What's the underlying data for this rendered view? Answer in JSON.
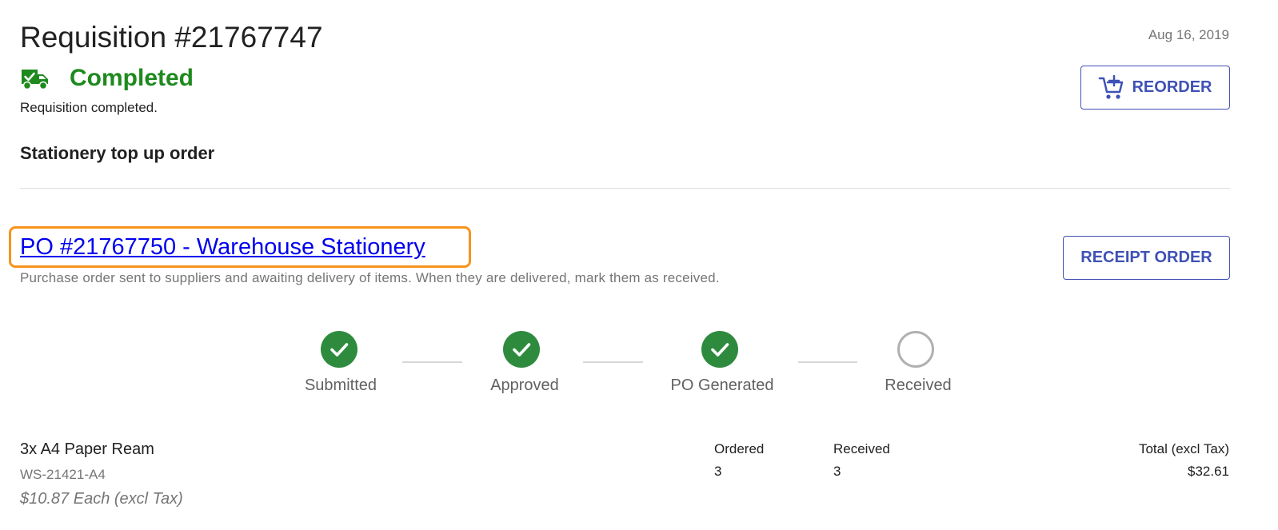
{
  "requisition": {
    "title": "Requisition #21767747",
    "date": "Aug 16, 2019",
    "status": "Completed",
    "status_description": "Requisition completed.",
    "name": "Stationery top up order",
    "reorder_label": "REORDER"
  },
  "purchase_order": {
    "link_text": "PO #21767750 - Warehouse Stationery",
    "description": "Purchase order sent to suppliers and awaiting delivery of items. When they are delivered, mark them as received.",
    "receipt_label": "RECEIPT ORDER"
  },
  "steps": [
    {
      "label": "Submitted",
      "state": "done"
    },
    {
      "label": "Approved",
      "state": "done"
    },
    {
      "label": "PO Generated",
      "state": "done"
    },
    {
      "label": "Received",
      "state": "pending"
    }
  ],
  "line_items": [
    {
      "name": "3x A4 Paper Ream",
      "sku": "WS-21421-A4",
      "unit_price": "$10.87 Each (excl Tax)",
      "ordered_header": "Ordered",
      "ordered": "3",
      "received_header": "Received",
      "received": "3",
      "total_header": "Total (excl Tax)",
      "total": "$32.61"
    }
  ],
  "colors": {
    "status_green": "#1e8a1e",
    "step_done": "#2e8b3e",
    "accent": "#3f51b5",
    "link": "#0000ee",
    "highlight": "#f7941d"
  },
  "icons": {
    "status": "truck-check-icon",
    "reorder": "cart-plus-icon",
    "step_done": "check-circle-icon",
    "step_pending": "empty-circle-icon"
  }
}
